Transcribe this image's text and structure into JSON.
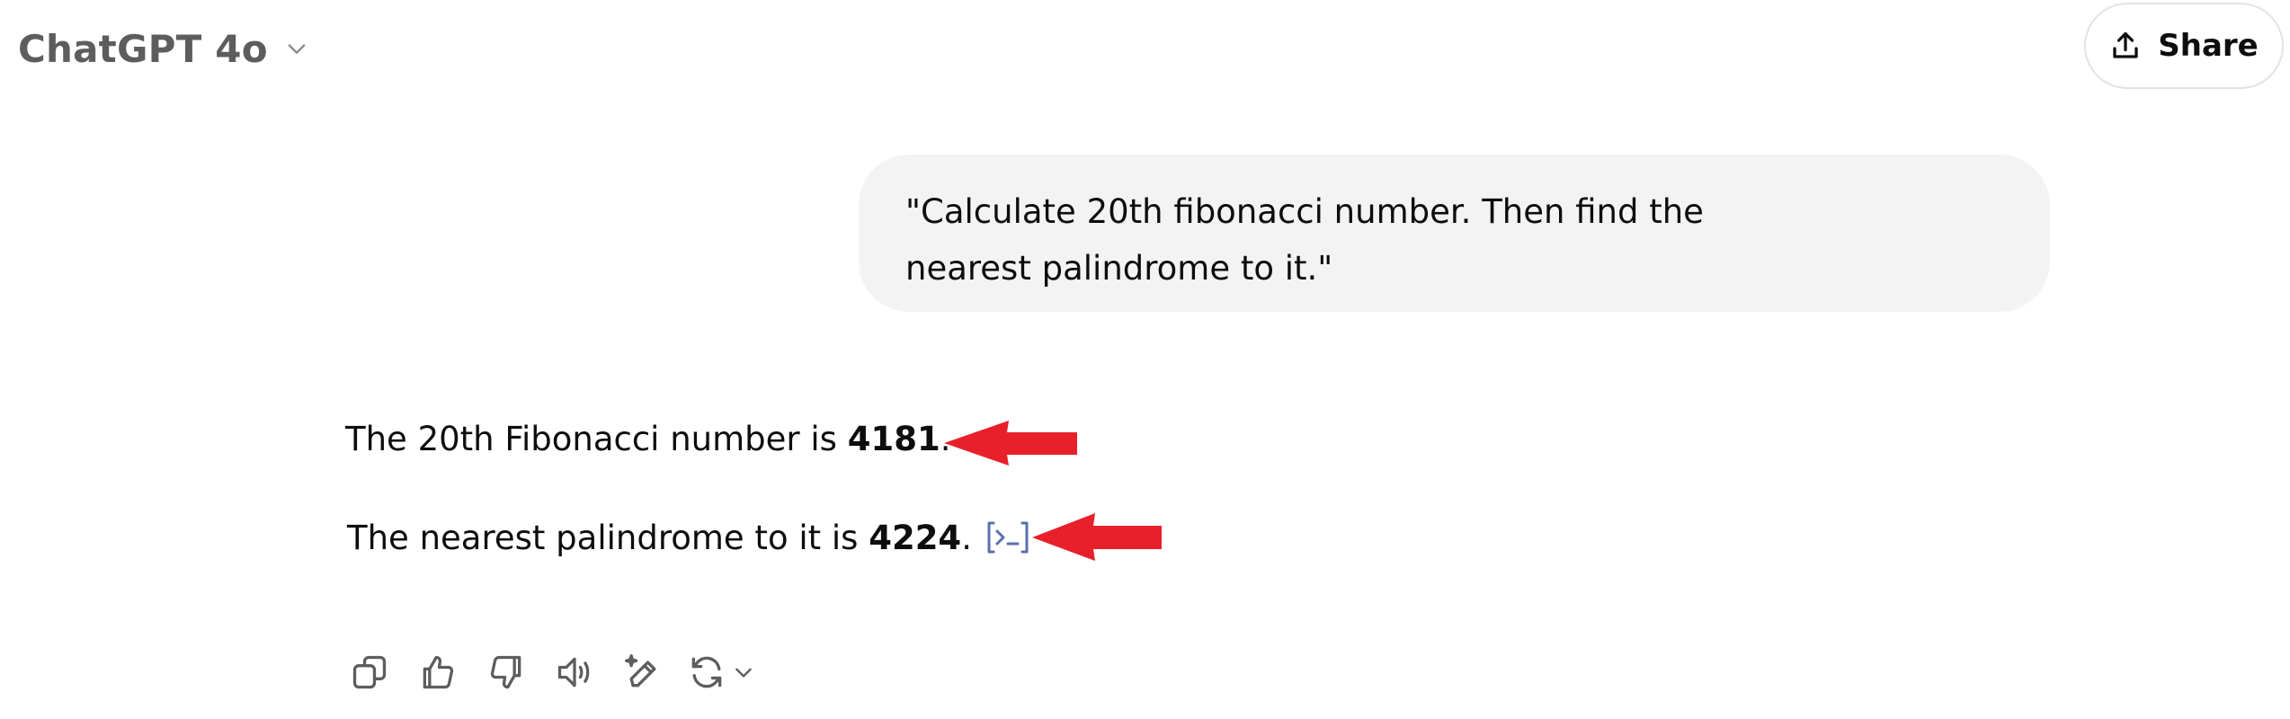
{
  "header": {
    "model_name": "ChatGPT 4o",
    "model_chevron_icon": "chevron-down-icon",
    "share_label": "Share",
    "share_icon": "upload-icon"
  },
  "conversation": {
    "user_message": "\"Calculate 20th fibonacci number. Then find the nearest palindrome to it.\"",
    "assistant": {
      "line1_prefix": "The 20th Fibonacci number is ",
      "line1_value": "4181",
      "line1_suffix": ".",
      "line2_prefix": "The nearest palindrome to it is ",
      "line2_value": "4224",
      "line2_suffix": ".",
      "code_chip_icon": "code-interpreter-icon"
    }
  },
  "annotations": {
    "arrow_color": "#e8202a",
    "arrow_icon": "red-arrow-left-icon"
  },
  "actions": [
    {
      "name": "copy",
      "icon": "copy-icon"
    },
    {
      "name": "good-response",
      "icon": "thumbs-up-icon"
    },
    {
      "name": "bad-response",
      "icon": "thumbs-down-icon"
    },
    {
      "name": "read-aloud",
      "icon": "speaker-icon"
    },
    {
      "name": "edit-in-canvas",
      "icon": "pen-sparkle-icon"
    },
    {
      "name": "regenerate",
      "icon": "refresh-icon"
    }
  ],
  "colors": {
    "bubble_bg": "#f3f3f3",
    "code_chip": "#5b6fb0",
    "icon_gray": "#5d5d5d"
  }
}
